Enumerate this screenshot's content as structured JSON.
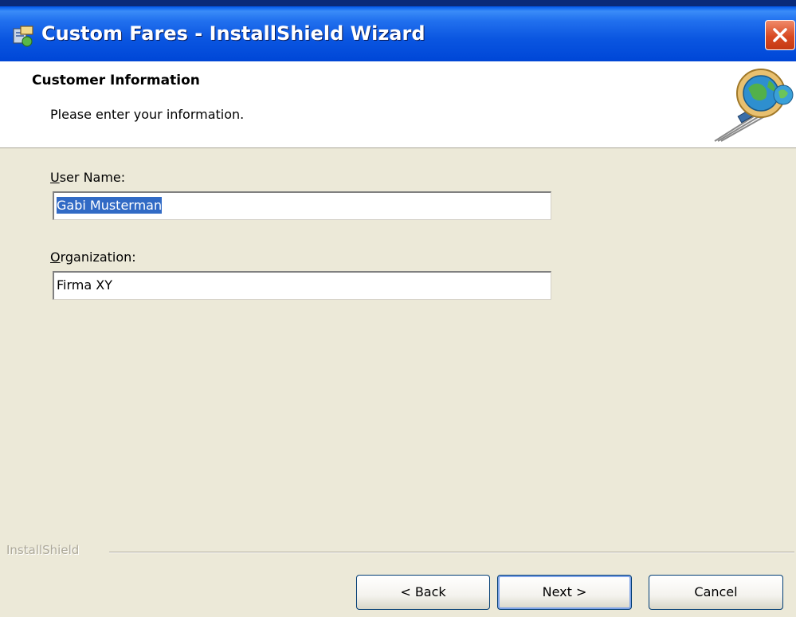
{
  "window": {
    "title": "Custom Fares - InstallShield Wizard"
  },
  "header": {
    "title": "Customer Information",
    "subtitle": "Please enter your information."
  },
  "form": {
    "user_name": {
      "label_prefix": "",
      "label_accel": "U",
      "label_rest": "ser Name:",
      "value": "Gabi Musterman"
    },
    "organization": {
      "label_prefix": "",
      "label_accel": "O",
      "label_rest": "rganization:",
      "value": "Firma XY"
    }
  },
  "footer": {
    "brand": "InstallShield",
    "back_label": "< Back",
    "next_label": "Next >",
    "cancel_label": "Cancel"
  },
  "icons": {
    "app": "installer-icon",
    "close": "close-icon",
    "header": "globe-computer-graphic"
  },
  "colors": {
    "title_bar": "#0054e3",
    "close_button": "#d84a22",
    "face": "#ece9d8",
    "selection": "#316ac5"
  }
}
